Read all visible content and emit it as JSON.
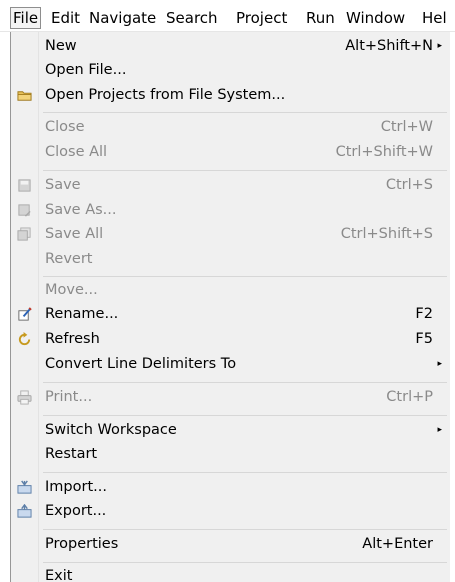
{
  "menubar": {
    "items": [
      "File",
      "Edit",
      "Navigate",
      "Search",
      "Project",
      "Run",
      "Window",
      "Hel"
    ]
  },
  "file_menu": {
    "items": [
      {
        "label": "New",
        "accel": "Alt+Shift+N",
        "submenu": true,
        "enabled": true,
        "icon": ""
      },
      {
        "label": "Open File...",
        "accel": "",
        "submenu": false,
        "enabled": true,
        "icon": ""
      },
      {
        "label": "Open Projects from File System...",
        "accel": "",
        "submenu": false,
        "enabled": true,
        "icon": "folder-icon"
      },
      {
        "label": "Close",
        "accel": "Ctrl+W",
        "submenu": false,
        "enabled": false,
        "icon": ""
      },
      {
        "label": "Close All",
        "accel": "Ctrl+Shift+W",
        "submenu": false,
        "enabled": false,
        "icon": ""
      },
      {
        "label": "Save",
        "accel": "Ctrl+S",
        "submenu": false,
        "enabled": false,
        "icon": "save-icon"
      },
      {
        "label": "Save As...",
        "accel": "",
        "submenu": false,
        "enabled": false,
        "icon": "save-as-icon"
      },
      {
        "label": "Save All",
        "accel": "Ctrl+Shift+S",
        "submenu": false,
        "enabled": false,
        "icon": "save-all-icon"
      },
      {
        "label": "Revert",
        "accel": "",
        "submenu": false,
        "enabled": false,
        "icon": ""
      },
      {
        "label": "Move...",
        "accel": "",
        "submenu": false,
        "enabled": false,
        "icon": ""
      },
      {
        "label": "Rename...",
        "accel": "F2",
        "submenu": false,
        "enabled": true,
        "icon": "rename-icon"
      },
      {
        "label": "Refresh",
        "accel": "F5",
        "submenu": false,
        "enabled": true,
        "icon": "refresh-icon"
      },
      {
        "label": "Convert Line Delimiters To",
        "accel": "",
        "submenu": true,
        "enabled": true,
        "icon": ""
      },
      {
        "label": "Print...",
        "accel": "Ctrl+P",
        "submenu": false,
        "enabled": false,
        "icon": "print-icon"
      },
      {
        "label": "Switch Workspace",
        "accel": "",
        "submenu": true,
        "enabled": true,
        "icon": ""
      },
      {
        "label": "Restart",
        "accel": "",
        "submenu": false,
        "enabled": true,
        "icon": ""
      },
      {
        "label": "Import...",
        "accel": "",
        "submenu": false,
        "enabled": true,
        "icon": "import-icon"
      },
      {
        "label": "Export...",
        "accel": "",
        "submenu": false,
        "enabled": true,
        "icon": "export-icon"
      },
      {
        "label": "Properties",
        "accel": "Alt+Enter",
        "submenu": false,
        "enabled": true,
        "icon": ""
      },
      {
        "label": "Exit",
        "accel": "",
        "submenu": false,
        "enabled": true,
        "icon": ""
      }
    ],
    "submenu_arrow": "▸"
  },
  "colors": {
    "menu_bg": "#f0f0f0",
    "disabled_text": "#8a8a8a",
    "separator": "#d7d7d7"
  }
}
